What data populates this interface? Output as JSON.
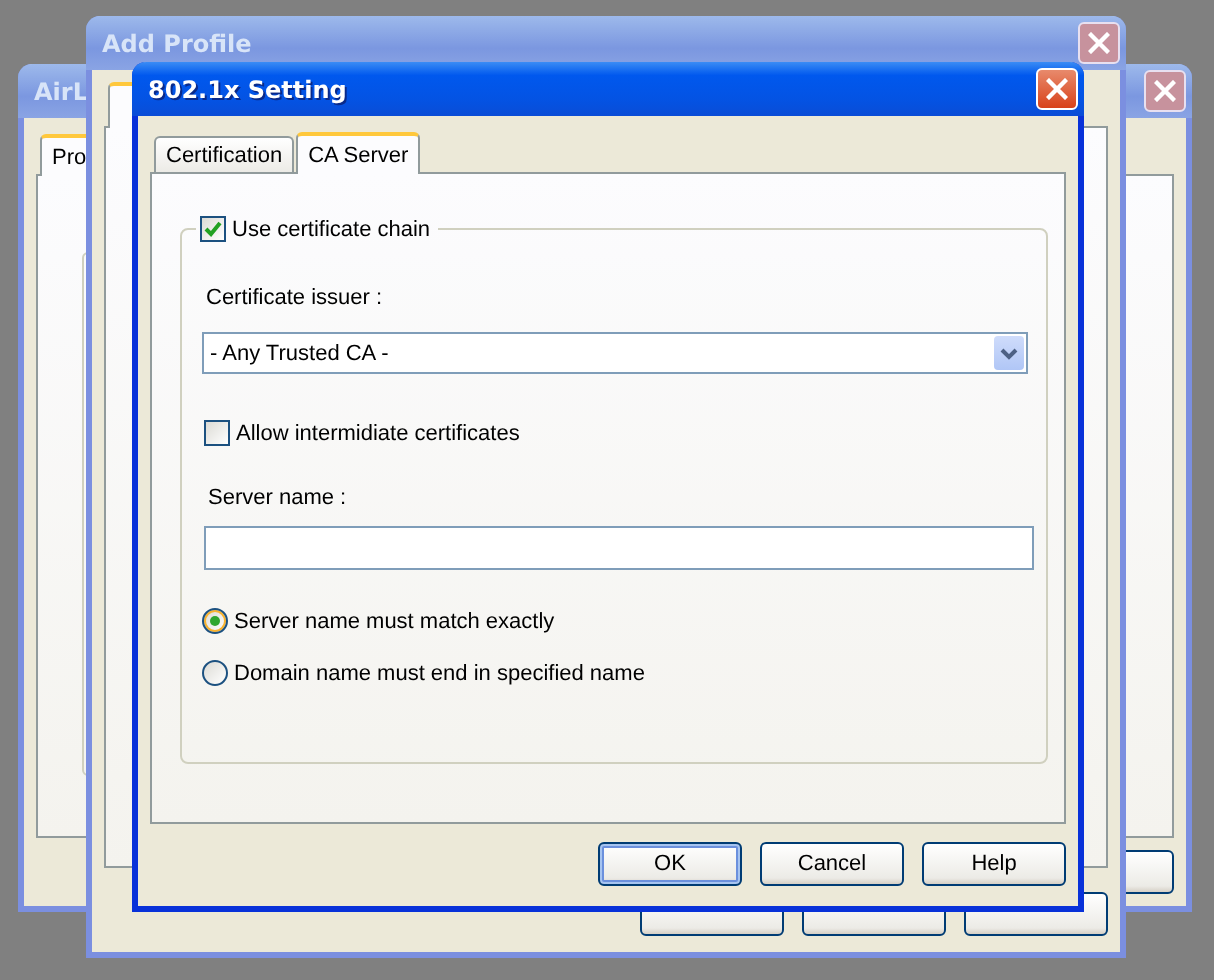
{
  "background_windows": [
    {
      "title": "AirL",
      "active": false,
      "tabs": [
        {
          "label": "Pro",
          "selected": true
        }
      ]
    },
    {
      "title": "Add Profile",
      "active": false
    }
  ],
  "dialog": {
    "title": "802.1x Setting",
    "active": true,
    "tabs": [
      {
        "label": "Certification",
        "selected": false
      },
      {
        "label": "CA Server",
        "selected": true
      }
    ],
    "use_certificate_chain": {
      "label": "Use certificate chain",
      "checked": true
    },
    "certificate_issuer": {
      "label": "Certificate issuer :",
      "value": "- Any Trusted CA -"
    },
    "allow_intermediate": {
      "label": "Allow intermidiate certificates",
      "checked": false
    },
    "server_name": {
      "label": "Server name :"
    },
    "match_options": [
      {
        "label": "Server name must match exactly",
        "selected": true
      },
      {
        "label": "Domain name must end in specified name",
        "selected": false
      }
    ],
    "buttons": [
      {
        "label": "OK",
        "default": true
      },
      {
        "label": "Cancel",
        "default": false
      },
      {
        "label": "Help",
        "default": false
      }
    ]
  }
}
